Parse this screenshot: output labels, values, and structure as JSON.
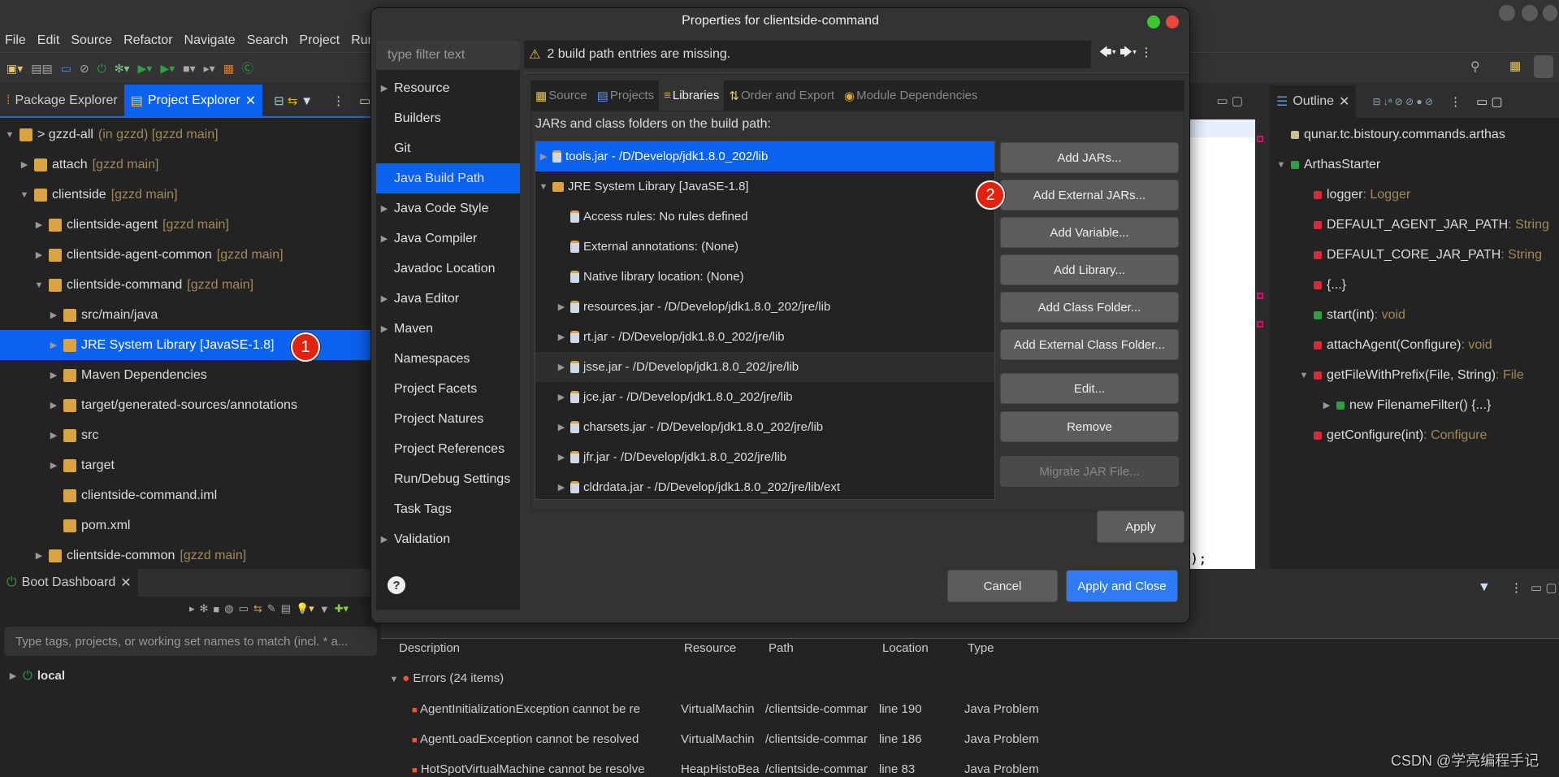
{
  "menu": [
    "File",
    "Edit",
    "Source",
    "Refactor",
    "Navigate",
    "Search",
    "Project",
    "Run"
  ],
  "left_tabs": {
    "package_explorer": "Package Explorer",
    "project_explorer": "Project Explorer"
  },
  "project_tree": [
    {
      "label": "> gzzd-all",
      "dec": "(in gzzd) [gzzd main]",
      "indent": 0,
      "twisty": "open"
    },
    {
      "label": "attach",
      "dec": "[gzzd main]",
      "indent": 1,
      "twisty": "closed"
    },
    {
      "label": "clientside",
      "dec": "[gzzd main]",
      "indent": 1,
      "twisty": "open"
    },
    {
      "label": "clientside-agent",
      "dec": "[gzzd main]",
      "indent": 2,
      "twisty": "closed"
    },
    {
      "label": "clientside-agent-common",
      "dec": "[gzzd main]",
      "indent": 2,
      "twisty": "closed"
    },
    {
      "label": "clientside-command",
      "dec": "[gzzd main]",
      "indent": 2,
      "twisty": "open"
    },
    {
      "label": "src/main/java",
      "dec": "",
      "indent": 3,
      "twisty": "closed"
    },
    {
      "label": "JRE System Library [JavaSE-1.8]",
      "dec": "",
      "indent": 3,
      "twisty": "closed",
      "selected": true
    },
    {
      "label": "Maven Dependencies",
      "dec": "",
      "indent": 3,
      "twisty": "closed"
    },
    {
      "label": "target/generated-sources/annotations",
      "dec": "",
      "indent": 3,
      "twisty": "closed"
    },
    {
      "label": "src",
      "dec": "",
      "indent": 3,
      "twisty": "closed"
    },
    {
      "label": "target",
      "dec": "",
      "indent": 3,
      "twisty": "closed"
    },
    {
      "label": "clientside-command.iml",
      "dec": "",
      "indent": 3,
      "twisty": "none"
    },
    {
      "label": "pom.xml",
      "dec": "",
      "indent": 3,
      "twisty": "none"
    },
    {
      "label": "clientside-common",
      "dec": "[gzzd main]",
      "indent": 2,
      "twisty": "closed"
    }
  ],
  "step_badges": [
    "1",
    "2"
  ],
  "boot_dashboard": {
    "tab": "Boot Dashboard",
    "filter_placeholder": "Type tags, projects, or working set names to match (incl. * a...",
    "item": "local"
  },
  "dialog": {
    "title": "Properties for clientside-command",
    "filter_placeholder": "type filter text",
    "warning": "2 build path entries are missing.",
    "nav": [
      {
        "label": "Resource",
        "expandable": true
      },
      {
        "label": "Builders"
      },
      {
        "label": "Git"
      },
      {
        "label": "Java Build Path",
        "selected": true
      },
      {
        "label": "Java Code Style",
        "expandable": true
      },
      {
        "label": "Java Compiler",
        "expandable": true
      },
      {
        "label": "Javadoc Location"
      },
      {
        "label": "Java Editor",
        "expandable": true
      },
      {
        "label": "Maven",
        "expandable": true
      },
      {
        "label": "Namespaces"
      },
      {
        "label": "Project Facets"
      },
      {
        "label": "Project Natures"
      },
      {
        "label": "Project References"
      },
      {
        "label": "Run/Debug Settings"
      },
      {
        "label": "Task Tags"
      },
      {
        "label": "Validation",
        "expandable": true
      }
    ],
    "tabs": [
      "Source",
      "Projects",
      "Libraries",
      "Order and Export",
      "Module Dependencies"
    ],
    "active_tab": "Libraries",
    "list_label": "JARs and class folders on the build path:",
    "libraries": [
      {
        "label": "tools.jar - /D/Develop/jdk1.8.0_202/lib",
        "indent": 0,
        "twisty": "closed",
        "selected": true
      },
      {
        "label": "JRE System Library [JavaSE-1.8]",
        "indent": 0,
        "twisty": "open"
      },
      {
        "label": "Access rules: No rules defined",
        "indent": 1,
        "twisty": "none"
      },
      {
        "label": "External annotations: (None)",
        "indent": 1,
        "twisty": "none"
      },
      {
        "label": "Native library location: (None)",
        "indent": 1,
        "twisty": "none"
      },
      {
        "label": "resources.jar - /D/Develop/jdk1.8.0_202/jre/lib",
        "indent": 1,
        "twisty": "closed"
      },
      {
        "label": "rt.jar - /D/Develop/jdk1.8.0_202/jre/lib",
        "indent": 1,
        "twisty": "closed"
      },
      {
        "label": "jsse.jar - /D/Develop/jdk1.8.0_202/jre/lib",
        "indent": 1,
        "twisty": "closed",
        "hover": true
      },
      {
        "label": "jce.jar - /D/Develop/jdk1.8.0_202/jre/lib",
        "indent": 1,
        "twisty": "closed"
      },
      {
        "label": "charsets.jar - /D/Develop/jdk1.8.0_202/jre/lib",
        "indent": 1,
        "twisty": "closed"
      },
      {
        "label": "jfr.jar - /D/Develop/jdk1.8.0_202/jre/lib",
        "indent": 1,
        "twisty": "closed"
      },
      {
        "label": "cldrdata.jar - /D/Develop/jdk1.8.0_202/jre/lib/ext",
        "indent": 1,
        "twisty": "closed"
      }
    ],
    "buttons": {
      "add_jars": "Add JARs...",
      "add_external_jars": "Add External JARs...",
      "add_variable": "Add Variable...",
      "add_library": "Add Library...",
      "add_class_folder": "Add Class Folder...",
      "add_external_class_folder": "Add External Class Folder...",
      "edit": "Edit...",
      "remove": "Remove",
      "migrate": "Migrate JAR File...",
      "apply": "Apply",
      "cancel": "Cancel",
      "apply_close": "Apply and Close"
    }
  },
  "outline": {
    "tab": "Outline",
    "items": [
      {
        "label": "qunar.tc.bistoury.commands.arthas",
        "type": "",
        "indent": 0
      },
      {
        "label": "ArthasStarter",
        "type": "",
        "indent": 0,
        "twisty": "open"
      },
      {
        "label": "logger",
        "type": " : Logger",
        "indent": 1
      },
      {
        "label": "DEFAULT_AGENT_JAR_PATH",
        "type": " : String",
        "indent": 1
      },
      {
        "label": "DEFAULT_CORE_JAR_PATH",
        "type": " : String",
        "indent": 1
      },
      {
        "label": "{...}",
        "type": "",
        "indent": 1
      },
      {
        "label": "start(int)",
        "type": " : void",
        "indent": 1
      },
      {
        "label": "attachAgent(Configure)",
        "type": " : void",
        "indent": 1
      },
      {
        "label": "getFileWithPrefix(File, String)",
        "type": " : File",
        "indent": 1,
        "twisty": "open"
      },
      {
        "label": "new FilenameFilter() {...}",
        "type": "",
        "indent": 2,
        "twisty": "closed"
      },
      {
        "label": "getConfigure(int)",
        "type": " : Configure",
        "indent": 1
      }
    ]
  },
  "editor": {
    "code_fragment": ");"
  },
  "problems": {
    "columns": [
      "Description",
      "Resource",
      "Path",
      "Location",
      "Type"
    ],
    "group": "Errors (24 items)",
    "rows": [
      [
        "AgentInitializationException cannot be re",
        "VirtualMachin",
        "/clientside-commar",
        "line 190",
        "Java Problem"
      ],
      [
        "AgentLoadException cannot be resolved",
        "VirtualMachin",
        "/clientside-commar",
        "line 186",
        "Java Problem"
      ],
      [
        "HotSpotVirtualMachine cannot be resolve",
        "HeapHistoBea",
        "/clientside-commar",
        "line 83",
        "Java Problem"
      ]
    ]
  },
  "watermark": "CSDN @学亮编程手记",
  "colors": {
    "accent": "#0b62f0",
    "badge": "#e2220f",
    "primary_button": "#2f7bf5"
  }
}
